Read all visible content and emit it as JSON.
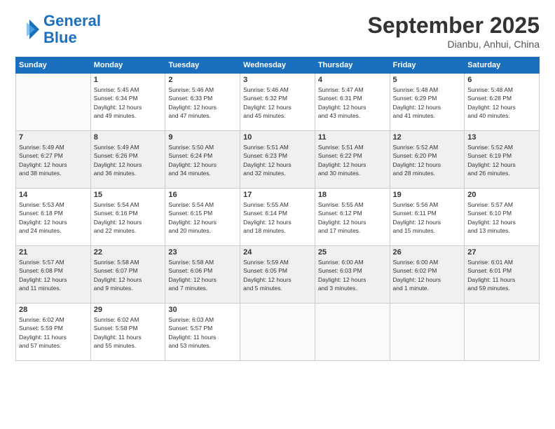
{
  "logo": {
    "line1": "General",
    "line2": "Blue"
  },
  "title": "September 2025",
  "location": "Dianbu, Anhui, China",
  "headers": [
    "Sunday",
    "Monday",
    "Tuesday",
    "Wednesday",
    "Thursday",
    "Friday",
    "Saturday"
  ],
  "weeks": [
    [
      {
        "day": "",
        "info": ""
      },
      {
        "day": "1",
        "info": "Sunrise: 5:45 AM\nSunset: 6:34 PM\nDaylight: 12 hours\nand 49 minutes."
      },
      {
        "day": "2",
        "info": "Sunrise: 5:46 AM\nSunset: 6:33 PM\nDaylight: 12 hours\nand 47 minutes."
      },
      {
        "day": "3",
        "info": "Sunrise: 5:46 AM\nSunset: 6:32 PM\nDaylight: 12 hours\nand 45 minutes."
      },
      {
        "day": "4",
        "info": "Sunrise: 5:47 AM\nSunset: 6:31 PM\nDaylight: 12 hours\nand 43 minutes."
      },
      {
        "day": "5",
        "info": "Sunrise: 5:48 AM\nSunset: 6:29 PM\nDaylight: 12 hours\nand 41 minutes."
      },
      {
        "day": "6",
        "info": "Sunrise: 5:48 AM\nSunset: 6:28 PM\nDaylight: 12 hours\nand 40 minutes."
      }
    ],
    [
      {
        "day": "7",
        "info": "Sunrise: 5:49 AM\nSunset: 6:27 PM\nDaylight: 12 hours\nand 38 minutes."
      },
      {
        "day": "8",
        "info": "Sunrise: 5:49 AM\nSunset: 6:26 PM\nDaylight: 12 hours\nand 36 minutes."
      },
      {
        "day": "9",
        "info": "Sunrise: 5:50 AM\nSunset: 6:24 PM\nDaylight: 12 hours\nand 34 minutes."
      },
      {
        "day": "10",
        "info": "Sunrise: 5:51 AM\nSunset: 6:23 PM\nDaylight: 12 hours\nand 32 minutes."
      },
      {
        "day": "11",
        "info": "Sunrise: 5:51 AM\nSunset: 6:22 PM\nDaylight: 12 hours\nand 30 minutes."
      },
      {
        "day": "12",
        "info": "Sunrise: 5:52 AM\nSunset: 6:20 PM\nDaylight: 12 hours\nand 28 minutes."
      },
      {
        "day": "13",
        "info": "Sunrise: 5:52 AM\nSunset: 6:19 PM\nDaylight: 12 hours\nand 26 minutes."
      }
    ],
    [
      {
        "day": "14",
        "info": "Sunrise: 5:53 AM\nSunset: 6:18 PM\nDaylight: 12 hours\nand 24 minutes."
      },
      {
        "day": "15",
        "info": "Sunrise: 5:54 AM\nSunset: 6:16 PM\nDaylight: 12 hours\nand 22 minutes."
      },
      {
        "day": "16",
        "info": "Sunrise: 5:54 AM\nSunset: 6:15 PM\nDaylight: 12 hours\nand 20 minutes."
      },
      {
        "day": "17",
        "info": "Sunrise: 5:55 AM\nSunset: 6:14 PM\nDaylight: 12 hours\nand 18 minutes."
      },
      {
        "day": "18",
        "info": "Sunrise: 5:55 AM\nSunset: 6:12 PM\nDaylight: 12 hours\nand 17 minutes."
      },
      {
        "day": "19",
        "info": "Sunrise: 5:56 AM\nSunset: 6:11 PM\nDaylight: 12 hours\nand 15 minutes."
      },
      {
        "day": "20",
        "info": "Sunrise: 5:57 AM\nSunset: 6:10 PM\nDaylight: 12 hours\nand 13 minutes."
      }
    ],
    [
      {
        "day": "21",
        "info": "Sunrise: 5:57 AM\nSunset: 6:08 PM\nDaylight: 12 hours\nand 11 minutes."
      },
      {
        "day": "22",
        "info": "Sunrise: 5:58 AM\nSunset: 6:07 PM\nDaylight: 12 hours\nand 9 minutes."
      },
      {
        "day": "23",
        "info": "Sunrise: 5:58 AM\nSunset: 6:06 PM\nDaylight: 12 hours\nand 7 minutes."
      },
      {
        "day": "24",
        "info": "Sunrise: 5:59 AM\nSunset: 6:05 PM\nDaylight: 12 hours\nand 5 minutes."
      },
      {
        "day": "25",
        "info": "Sunrise: 6:00 AM\nSunset: 6:03 PM\nDaylight: 12 hours\nand 3 minutes."
      },
      {
        "day": "26",
        "info": "Sunrise: 6:00 AM\nSunset: 6:02 PM\nDaylight: 12 hours\nand 1 minute."
      },
      {
        "day": "27",
        "info": "Sunrise: 6:01 AM\nSunset: 6:01 PM\nDaylight: 11 hours\nand 59 minutes."
      }
    ],
    [
      {
        "day": "28",
        "info": "Sunrise: 6:02 AM\nSunset: 5:59 PM\nDaylight: 11 hours\nand 57 minutes."
      },
      {
        "day": "29",
        "info": "Sunrise: 6:02 AM\nSunset: 5:58 PM\nDaylight: 11 hours\nand 55 minutes."
      },
      {
        "day": "30",
        "info": "Sunrise: 6:03 AM\nSunset: 5:57 PM\nDaylight: 11 hours\nand 53 minutes."
      },
      {
        "day": "",
        "info": ""
      },
      {
        "day": "",
        "info": ""
      },
      {
        "day": "",
        "info": ""
      },
      {
        "day": "",
        "info": ""
      }
    ]
  ]
}
